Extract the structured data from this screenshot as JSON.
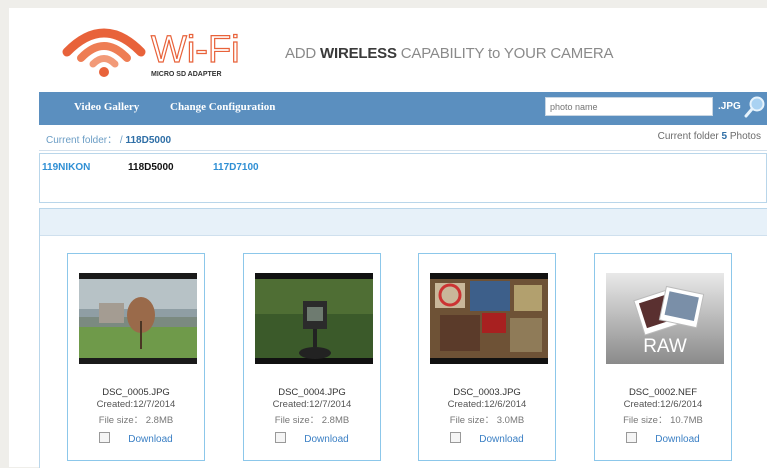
{
  "header": {
    "logo_text": "Wi-Fi",
    "logo_subtext": "MICRO SD ADAPTER",
    "tagline_pre": "ADD ",
    "tagline_bold": "WIRELESS",
    "tagline_post": " CAPABILITY to YOUR CAMERA"
  },
  "nav": {
    "video_gallery": "Video Gallery",
    "change_configuration": "Change Configuration",
    "search_placeholder": "photo name",
    "search_ext": ".JPG"
  },
  "folder_bar": {
    "label": "Current folder： /",
    "current": "118D5000",
    "count_prefix": "Current folder",
    "count_value": "5",
    "count_suffix": "Photos"
  },
  "folders": [
    "119NIKON",
    "118D5000",
    "117D7100"
  ],
  "photos": [
    {
      "name": "DSC_0005.JPG",
      "created": "Created:12/7/2014",
      "size": "File size： 2.8MB",
      "download": "Download"
    },
    {
      "name": "DSC_0004.JPG",
      "created": "Created:12/7/2014",
      "size": "File size： 2.8MB",
      "download": "Download"
    },
    {
      "name": "DSC_0003.JPG",
      "created": "Created:12/6/2014",
      "size": "File size： 3.0MB",
      "download": "Download"
    },
    {
      "name": "DSC_0002.NEF",
      "created": "Created:12/6/2014",
      "size": "File size： 10.7MB",
      "download": "Download",
      "badge": "RAW"
    }
  ],
  "colors": {
    "accent": "#5b8fbf",
    "link": "#2f8fd4",
    "card_border": "#8cc7ea"
  }
}
